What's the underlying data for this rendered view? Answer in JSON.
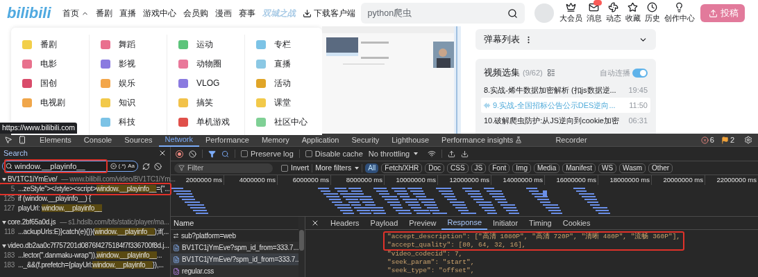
{
  "header": {
    "logo": "bilibili",
    "nav": [
      {
        "label": "首页",
        "kind": "menu"
      },
      {
        "label": "番剧",
        "kind": "link"
      },
      {
        "label": "直播",
        "kind": "link"
      },
      {
        "label": "游戏中心",
        "kind": "link"
      },
      {
        "label": "会员购",
        "kind": "link"
      },
      {
        "label": "漫画",
        "kind": "link"
      },
      {
        "label": "赛事",
        "kind": "link"
      },
      {
        "label": "双城之战",
        "kind": "promo"
      },
      {
        "label": "下载客户端",
        "kind": "download"
      }
    ],
    "search": {
      "value": "python爬虫"
    },
    "actions": [
      {
        "label": "大会员",
        "kind": "vip",
        "badge": false
      },
      {
        "label": "消息",
        "kind": "message",
        "badge": true
      },
      {
        "label": "动态",
        "kind": "dynamic",
        "badge": false
      },
      {
        "label": "收藏",
        "kind": "favorite",
        "badge": false
      },
      {
        "label": "历史",
        "kind": "history",
        "badge": false
      },
      {
        "label": "创作中心",
        "kind": "creator",
        "badge": false
      }
    ],
    "upload_button": "投稿"
  },
  "category_menu": {
    "columns": [
      [
        "番剧",
        "电影",
        "国创",
        "电视剧"
      ],
      [
        "舞蹈",
        "影视",
        "娱乐",
        "知识",
        "科技"
      ],
      [
        "运动",
        "动物圈",
        "VLOG",
        "搞笑",
        "单机游戏"
      ],
      [
        "专栏",
        "直播",
        "活动",
        "课堂",
        "社区中心"
      ]
    ]
  },
  "status_url": "https://www.bilibili.com",
  "danmaku_panel": {
    "title": "弹幕列表"
  },
  "playlist": {
    "title": "视频选集",
    "count": "(9/62)",
    "autoplay_label": "自动连播",
    "autoplay": true,
    "episodes": [
      {
        "title": "8.实战-烯牛数据加密解析 (扣js数据逆...",
        "duration": "19:45",
        "selected": false
      },
      {
        "title": "9.实战-全国招标公告公示DES逆向...",
        "duration": "11:50",
        "selected": true
      },
      {
        "title": "10.破解爬虫防护:从JS逆向到cookie加密",
        "duration": "06:31",
        "selected": false
      }
    ]
  },
  "devtools": {
    "tabs": [
      {
        "label": "Elements",
        "kind": "panel",
        "selected": false
      },
      {
        "label": "Console",
        "kind": "panel",
        "selected": false
      },
      {
        "label": "Sources",
        "kind": "panel",
        "selected": false
      },
      {
        "label": "Network",
        "kind": "panel",
        "selected": true
      },
      {
        "label": "Performance",
        "kind": "panel",
        "selected": false
      },
      {
        "label": "Memory",
        "kind": "panel",
        "selected": false
      },
      {
        "label": "Application",
        "kind": "panel",
        "selected": false
      },
      {
        "label": "Security",
        "kind": "panel",
        "selected": false
      },
      {
        "label": "Lighthouse",
        "kind": "panel",
        "selected": false
      },
      {
        "label": "Performance insights",
        "kind": "experiment",
        "selected": false
      },
      {
        "label": "Recorder",
        "kind": "panel",
        "selected": false
      }
    ],
    "errors": "6",
    "warnings": "2"
  },
  "search_panel": {
    "title": "Search",
    "query": "window.__playinfo__",
    "query_marked": true,
    "regex": "(.*)",
    "match_case": "Aa",
    "groups": [
      {
        "file": "BV1TC1iYmEve/",
        "url": "— www.bilibili.com/video/BV1TC1iYm...",
        "expanded": true,
        "results": [
          {
            "line": "5",
            "pre": "...zeStyle\"></style><script>",
            "match": "window.__playinfo__",
            "post": "={\"...",
            "highlighted": true,
            "marked": true
          },
          {
            "line": "125",
            "pre": "if (",
            "match": "window.__playinfo__",
            "post": ") {",
            "highlighted": false,
            "marked": false
          },
          {
            "line": "127",
            "pre": "playUrl: ",
            "match": "window.__playinfo__",
            "highlighted": true,
            "marked": false
          }
        ]
      },
      {
        "file": "core.2bf65a0d.js",
        "url": "— s1.hdslb.com/bfs/static/player/ma...",
        "expanded": true,
        "results": [
          {
            "line": "118",
            "pre": "...ackupUrls:E)}catch(e){}}(",
            "match": "window.__playinfo__",
            "post": ");if(...",
            "highlighted": true,
            "marked": false
          }
        ]
      },
      {
        "file": "video.db2aa0c7f757201d0876f4275184f7f336700f8d.j...",
        "expanded": true,
        "results": [
          {
            "line": "183",
            "pre": "...lector(\".danmaku-wrap\")),",
            "match": "window.__playinfo__",
            "post": "...",
            "highlighted": true,
            "marked": false
          },
          {
            "line": "183",
            "pre": "..._&&(f.prefetch={playUrl:",
            "match": "window.__playinfo__",
            "post": "}),...",
            "highlighted": true,
            "marked": false
          }
        ]
      }
    ]
  },
  "network": {
    "preserve_log_label": "Preserve log",
    "preserve_log": false,
    "disable_cache_label": "Disable cache",
    "disable_cache": false,
    "throttling": "No throttling",
    "filter_placeholder": "Filter",
    "invert_label": "Invert",
    "invert": false,
    "more_filters": "More filters",
    "types": [
      {
        "label": "All",
        "selected": true
      },
      {
        "label": "Fetch/XHR",
        "selected": false
      },
      {
        "label": "Doc",
        "selected": false
      },
      {
        "label": "CSS",
        "selected": false
      },
      {
        "label": "JS",
        "selected": false
      },
      {
        "label": "Font",
        "selected": false
      },
      {
        "label": "Img",
        "selected": false
      },
      {
        "label": "Media",
        "selected": false
      },
      {
        "label": "Manifest",
        "selected": false
      },
      {
        "label": "WS",
        "selected": false
      },
      {
        "label": "Wasm",
        "selected": false
      },
      {
        "label": "Other",
        "selected": false
      }
    ],
    "ticks": [
      "2000000 ms",
      "4000000 ms",
      "6000000 ms",
      "8000000 ms",
      "10000000 ms",
      "12000000 ms",
      "14000000 ms",
      "16000000 ms",
      "18000000 ms",
      "20000000 ms",
      "22000000 ms"
    ],
    "name_header": "Name",
    "requests": [
      {
        "name": "sub?platform=web",
        "kind": "fetch",
        "selected": false
      },
      {
        "name": "BV1TC1jYmEve?spm_id_from=333.7...",
        "kind": "doc",
        "selected": false
      },
      {
        "name": "BV1TC1jYmEve/?spm_id_from=333.7...",
        "kind": "doc",
        "selected": true
      },
      {
        "name": "regular.css",
        "kind": "css",
        "selected": false
      }
    ],
    "detail_tabs": [
      {
        "label": "Headers",
        "selected": false
      },
      {
        "label": "Payload",
        "selected": false
      },
      {
        "label": "Preview",
        "selected": false
      },
      {
        "label": "Response",
        "selected": true
      },
      {
        "label": "Initiator",
        "selected": false
      },
      {
        "label": "Timing",
        "selected": false
      },
      {
        "label": "Cookies",
        "selected": false
      }
    ],
    "response_lines": [
      {
        "text": "\"accept_description\": [\"高清 1080P\", \"高清 720P\", \"清晰 480P\", \"流畅 360P\"],",
        "marked": true
      },
      {
        "text": "\"accept_quality\": [80, 64, 32, 16],",
        "marked": true
      },
      {
        "text": "\"video_codecid\": 7,",
        "marked": false
      },
      {
        "text": "\"seek_param\": \"start\",",
        "marked": false
      },
      {
        "text": "\"seek_type\": \"offset\",",
        "marked": false
      }
    ]
  }
}
